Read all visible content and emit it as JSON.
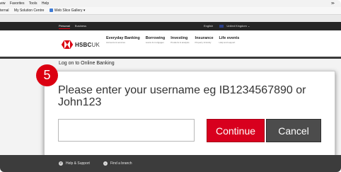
{
  "browser": {
    "menu": [
      "iew",
      "Favorites",
      "Tools",
      "Help"
    ],
    "right_control": "≫",
    "favorites_bar": [
      "ternal",
      "My Solution Centre",
      "Web Slice Gallery ▾"
    ]
  },
  "site": {
    "top_tabs": [
      "Personal",
      "Business"
    ],
    "language": "English",
    "region": "United Kingdom",
    "logo_text": "HSBC",
    "logo_country": "UK",
    "nav": [
      {
        "title": "Everyday Banking",
        "sub": "Accounts & services"
      },
      {
        "title": "Borrowing",
        "sub": "Loans & mortgages"
      },
      {
        "title": "Investing",
        "sub": "Products & analysis"
      },
      {
        "title": "Insurance",
        "sub": "Property & family"
      },
      {
        "title": "Life events",
        "sub": "Help and support"
      }
    ]
  },
  "login": {
    "heading": "Log on to Online Banking",
    "step": "5",
    "prompt": "Please enter your username eg IB1234567890 or John123",
    "username_value": "",
    "continue_label": "Continue",
    "cancel_label": "Cancel"
  },
  "footer": {
    "help": "Help & Support",
    "branch": "Find a branch"
  },
  "colors": {
    "brand_red": "#db0011",
    "button_red": "#d8001e",
    "button_gray": "#4c4c4c",
    "footer_dark": "#3c3c3c"
  }
}
